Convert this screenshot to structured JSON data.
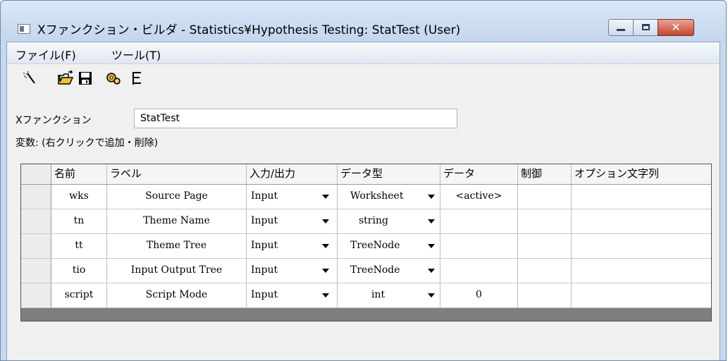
{
  "window": {
    "title": "Xファンクション・ビルダ - Statistics¥Hypothesis Testing: StatTest (User)",
    "close_glyph": "✕"
  },
  "menu": {
    "file": "ファイル(F)",
    "tools": "ツール(T)"
  },
  "toolbar": {
    "icons": [
      "wizard-icon",
      "open-folder-icon",
      "save-icon",
      "settings-gears-icon",
      "tree-view-icon"
    ]
  },
  "form": {
    "xfunction_label": "Xファンクション",
    "xfunction_value": "StatTest",
    "variables_label": "変数: (右クリックで追加・削除)"
  },
  "table": {
    "headers": [
      "名前",
      "ラベル",
      "入力/出力",
      "データ型",
      "データ",
      "制御",
      "オプション文字列"
    ],
    "rows": [
      {
        "name": "wks",
        "label": "Source Page",
        "io": "Input",
        "type": "Worksheet",
        "data": "<active>",
        "control": "",
        "option": ""
      },
      {
        "name": "tn",
        "label": "Theme Name",
        "io": "Input",
        "type": "string",
        "data": "",
        "control": "",
        "option": ""
      },
      {
        "name": "tt",
        "label": "Theme Tree",
        "io": "Input",
        "type": "TreeNode",
        "data": "",
        "control": "",
        "option": ""
      },
      {
        "name": "tio",
        "label": "Input Output Tree",
        "io": "Input",
        "type": "TreeNode",
        "data": "",
        "control": "",
        "option": ""
      },
      {
        "name": "script",
        "label": "Script Mode",
        "io": "Input",
        "type": "int",
        "data": "0",
        "control": "",
        "option": ""
      }
    ]
  }
}
